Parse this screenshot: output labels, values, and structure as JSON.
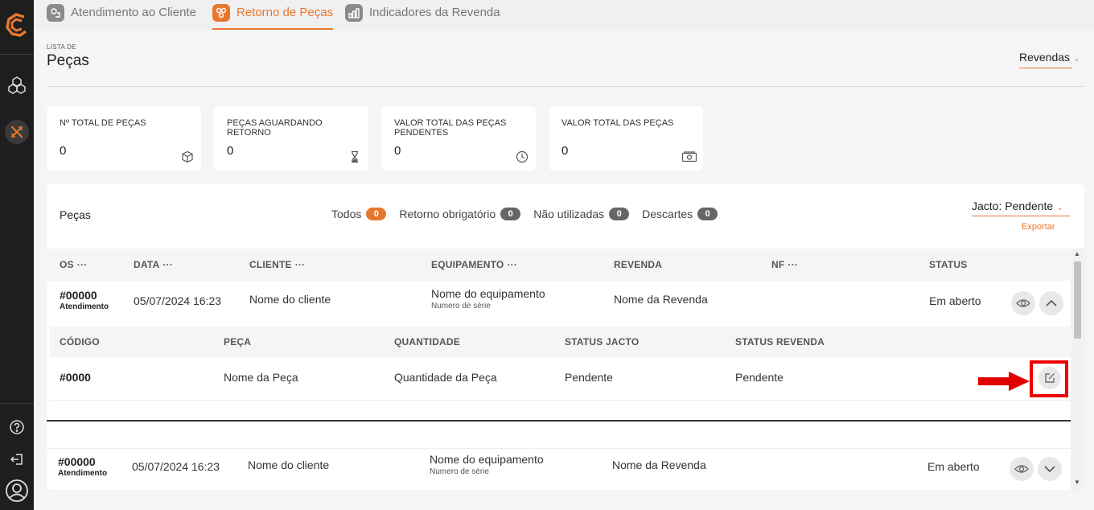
{
  "tabs": [
    {
      "label": "Atendimento ao Cliente",
      "icon": "headset-icon",
      "active": false
    },
    {
      "label": "Retorno de Peças",
      "icon": "parts-icon",
      "active": true
    },
    {
      "label": "Indicadores da Revenda",
      "icon": "bar-chart-icon",
      "active": false
    }
  ],
  "header": {
    "small": "LISTA DE",
    "title": "Peças",
    "revendas": "Revendas"
  },
  "stats": [
    {
      "label": "Nº TOTAL DE PEÇAS",
      "value": "0",
      "icon": "cube-icon"
    },
    {
      "label": "PEÇAS AGUARDANDO RETORNO",
      "value": "0",
      "icon": "hourglass-icon"
    },
    {
      "label": "VALOR TOTAL DAS PEÇAS PENDENTES",
      "value": "0",
      "icon": "clock-icon"
    },
    {
      "label": "VALOR TOTAL DAS PEÇAS",
      "value": "0",
      "icon": "money-icon"
    }
  ],
  "panel": {
    "title": "Peças",
    "filters": [
      {
        "label": "Todos",
        "count": "0"
      },
      {
        "label": "Retorno obrigatório",
        "count": "0"
      },
      {
        "label": "Não utilizadas",
        "count": "0"
      },
      {
        "label": "Descartes",
        "count": "0"
      }
    ],
    "jacto": "Jacto: Pendente",
    "exportar": "Exportar"
  },
  "columns": {
    "os": "OS",
    "data": "DATA",
    "cliente": "CLIENTE",
    "equipamento": "EQUIPAMENTO",
    "revenda": "REVENDA",
    "nf": "NF",
    "status": "STATUS",
    "dots": "···"
  },
  "rows": [
    {
      "os": "#00000",
      "os_sub": "Atendimento",
      "data": "05/07/2024 16:23",
      "cliente": "Nome do cliente",
      "equipamento": "Nome do equipamento",
      "serie": "Numero de série",
      "revenda": "Nome da Revenda",
      "status": "Em aberto"
    },
    {
      "os": "#00000",
      "os_sub": "Atendimento",
      "data": "05/07/2024 16:23",
      "cliente": "Nome do cliente",
      "equipamento": "Nome do equipamento",
      "serie": "Numero de série",
      "revenda": "Nome da Revenda",
      "status": "Em aberto"
    }
  ],
  "sub_columns": {
    "codigo": "CÓDIGO",
    "peca": "PEÇA",
    "quantidade": "QUANTIDADE",
    "status_jacto": "STATUS JACTO",
    "status_revenda": "STATUS REVENDA"
  },
  "sub_row": {
    "codigo": "#0000",
    "peca": "Nome da Peça",
    "quantidade": "Quantidade da Peça",
    "status_jacto": "Pendente",
    "status_revenda": "Pendente"
  },
  "colors": {
    "accent": "#e8772e",
    "sidebar": "#1e1e1e",
    "highlight": "#e00000"
  }
}
